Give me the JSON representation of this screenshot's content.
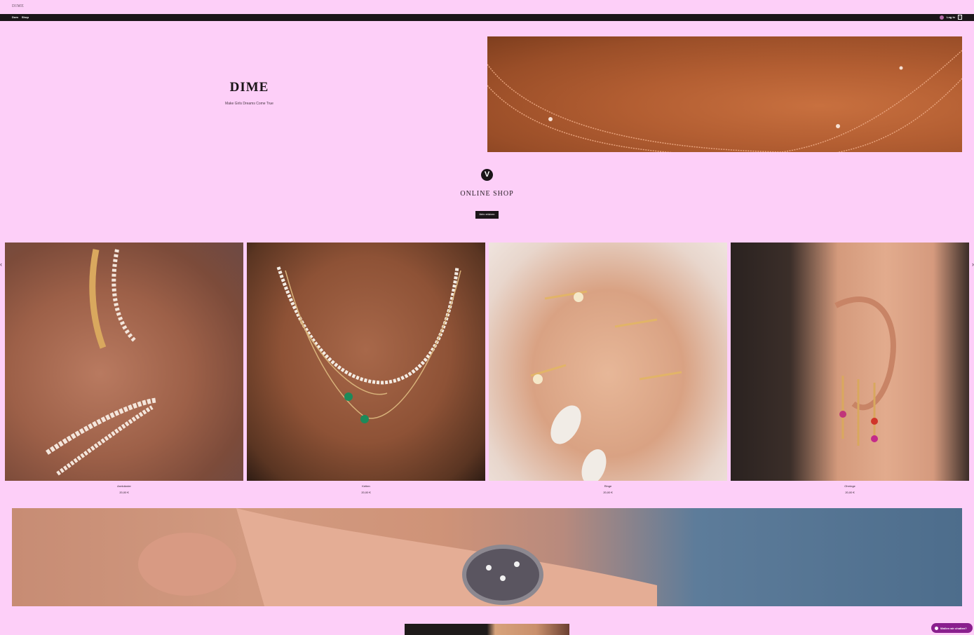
{
  "site": {
    "name": "DIME"
  },
  "nav": {
    "links": [
      "Dom",
      "Shop"
    ],
    "login_label": "Log in",
    "cart_count": "0"
  },
  "hero": {
    "brand_title": "DIME",
    "tagline": "Make Girls Dreams Come True"
  },
  "shop": {
    "logo_glyph": "V",
    "heading": "ONLINE SHOP",
    "button_label": "Mehr erfahren"
  },
  "carousel": {
    "prev": "‹",
    "next": "›"
  },
  "products": [
    {
      "name": "Armbänder",
      "price": "20,00 €",
      "image": "bracelets-photo"
    },
    {
      "name": "Ketten",
      "price": "20,00 €",
      "image": "necklaces-photo"
    },
    {
      "name": "Ringe",
      "price": "20,00 €",
      "image": "rings-photo"
    },
    {
      "name": "Ohrringe",
      "price": "20,00 €",
      "image": "earrings-photo"
    }
  ],
  "chat": {
    "label": "Wollen wir chatten?"
  },
  "colors": {
    "background": "#fdcff8",
    "navbar": "#1b1519",
    "chat_accent": "#8a1f8e"
  }
}
